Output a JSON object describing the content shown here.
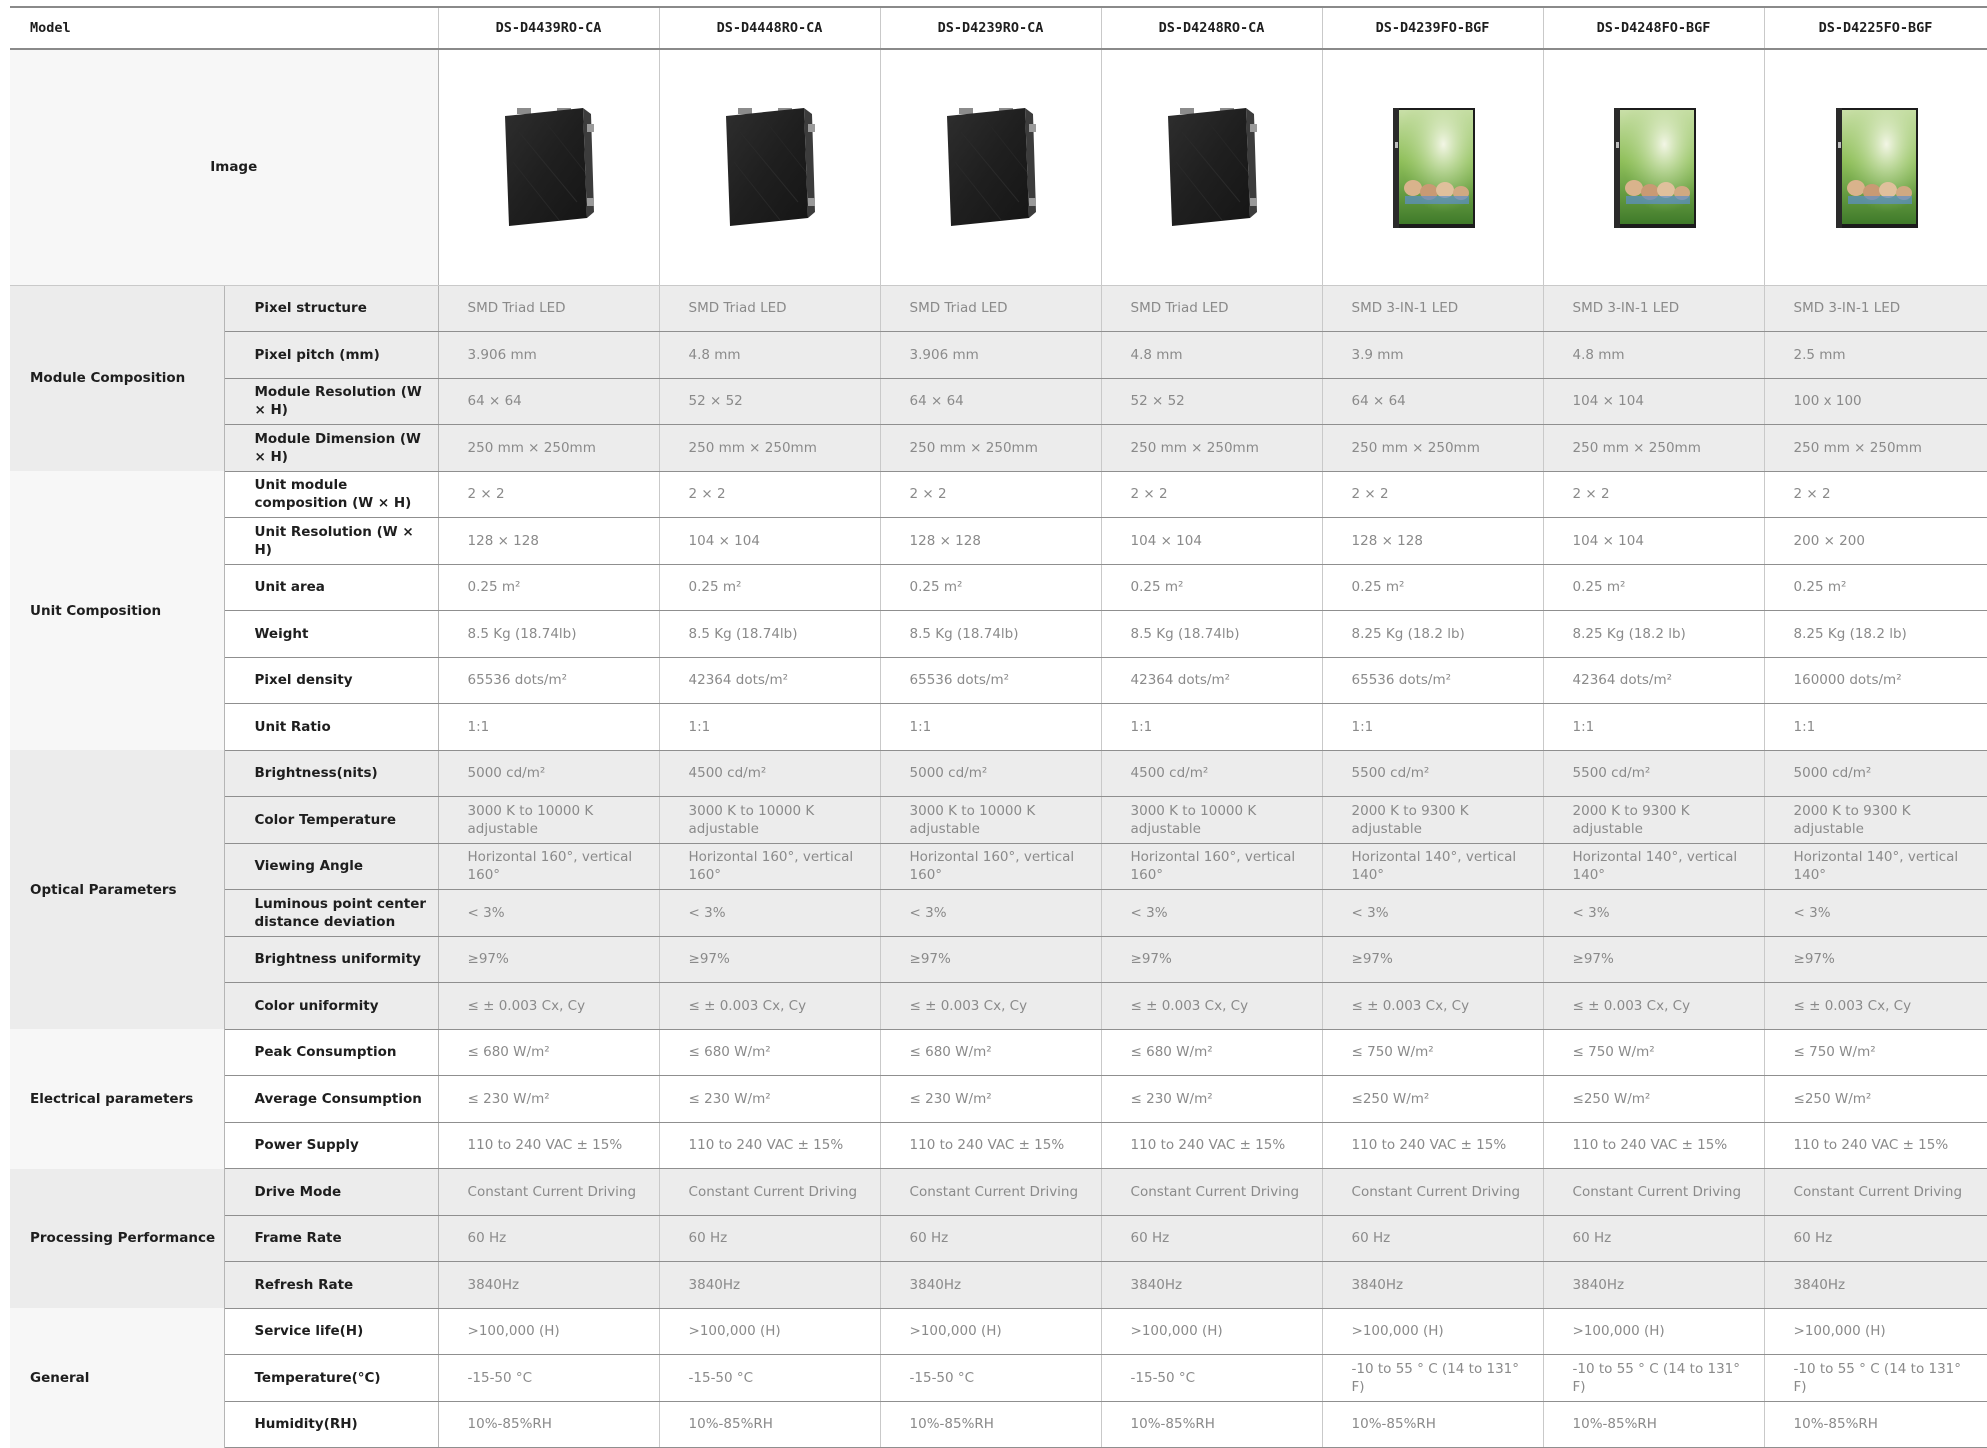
{
  "table": {
    "corner_label": "Model",
    "image_row_label": "Image",
    "models": [
      {
        "name": "DS-D4439RO-CA",
        "image": "dark-panel"
      },
      {
        "name": "DS-D4448RO-CA",
        "image": "dark-panel"
      },
      {
        "name": "DS-D4239RO-CA",
        "image": "dark-panel"
      },
      {
        "name": "DS-D4248RO-CA",
        "image": "dark-panel"
      },
      {
        "name": "DS-D4239FO-BGF",
        "image": "photo-panel"
      },
      {
        "name": "DS-D4248FO-BGF",
        "image": "photo-panel"
      },
      {
        "name": "DS-D4225FO-BGF",
        "image": "photo-panel"
      }
    ],
    "groups": [
      {
        "name": "Module Composition",
        "shaded": true,
        "rows": [
          {
            "param": "Pixel structure",
            "values": [
              "SMD Triad LED",
              "SMD Triad LED",
              "SMD Triad LED",
              "SMD Triad LED",
              "SMD 3-IN-1 LED",
              "SMD 3-IN-1 LED",
              "SMD 3-IN-1 LED"
            ]
          },
          {
            "param": "Pixel pitch (mm)",
            "values": [
              "3.906 mm",
              "4.8 mm",
              "3.906 mm",
              "4.8 mm",
              "3.9 mm",
              "4.8 mm",
              "2.5 mm"
            ]
          },
          {
            "param": "Module Resolution (W × H)",
            "values": [
              "64 × 64",
              "52 × 52",
              "64 × 64",
              "52 × 52",
              "64 × 64",
              "104 × 104",
              "100 x 100"
            ]
          },
          {
            "param": "Module Dimension (W × H)",
            "values": [
              "250 mm × 250mm",
              "250 mm × 250mm",
              "250 mm × 250mm",
              "250 mm × 250mm",
              "250 mm × 250mm",
              "250 mm × 250mm",
              "250 mm × 250mm"
            ]
          }
        ]
      },
      {
        "name": "Unit Composition",
        "shaded": false,
        "rows": [
          {
            "param": "Unit module composition (W × H)",
            "values": [
              "2 × 2",
              "2 × 2",
              "2 × 2",
              "2 × 2",
              "2 × 2",
              "2 × 2",
              "2 × 2"
            ]
          },
          {
            "param": "Unit Resolution (W × H)",
            "values": [
              "128 × 128",
              "104 × 104",
              "128 × 128",
              "104 × 104",
              "128 × 128",
              "104 × 104",
              "200 × 200"
            ]
          },
          {
            "param": "Unit area",
            "values": [
              "0.25 m²",
              "0.25 m²",
              "0.25 m²",
              "0.25 m²",
              "0.25 m²",
              "0.25 m²",
              "0.25 m²"
            ]
          },
          {
            "param": "Weight",
            "values": [
              "8.5 Kg (18.74lb)",
              "8.5 Kg (18.74lb)",
              "8.5 Kg (18.74lb)",
              "8.5 Kg (18.74lb)",
              "8.25 Kg (18.2 lb)",
              "8.25 Kg (18.2 lb)",
              "8.25 Kg (18.2 lb)"
            ]
          },
          {
            "param": "Pixel density",
            "values": [
              "65536 dots/m²",
              "42364 dots/m²",
              "65536 dots/m²",
              "42364 dots/m²",
              "65536 dots/m²",
              "42364 dots/m²",
              "160000 dots/m²"
            ]
          },
          {
            "param": "Unit Ratio",
            "values": [
              "1:1",
              "1:1",
              "1:1",
              "1:1",
              "1:1",
              "1:1",
              "1:1"
            ]
          }
        ]
      },
      {
        "name": "Optical Parameters",
        "shaded": true,
        "rows": [
          {
            "param": "Brightness(nits)",
            "values": [
              "5000 cd/m²",
              "4500 cd/m²",
              "5000 cd/m²",
              "4500 cd/m²",
              "5500 cd/m²",
              "5500 cd/m²",
              "5000 cd/m²"
            ]
          },
          {
            "param": "Color Temperature",
            "values": [
              "3000 K to 10000 K adjustable",
              "3000 K to 10000 K adjustable",
              "3000 K to 10000 K adjustable",
              "3000 K to 10000 K adjustable",
              "2000 K to 9300 K adjustable",
              "2000 K to 9300 K adjustable",
              "2000 K to 9300 K adjustable"
            ]
          },
          {
            "param": "Viewing Angle",
            "values": [
              "Horizontal 160°, vertical 160°",
              "Horizontal 160°, vertical 160°",
              "Horizontal 160°, vertical 160°",
              "Horizontal 160°, vertical 160°",
              "Horizontal 140°, vertical 140°",
              "Horizontal 140°, vertical 140°",
              "Horizontal 140°, vertical 140°"
            ]
          },
          {
            "param": "Luminous point center distance deviation",
            "values": [
              "< 3%",
              "< 3%",
              "< 3%",
              "< 3%",
              "< 3%",
              "< 3%",
              "< 3%"
            ]
          },
          {
            "param": "Brightness uniformity",
            "values": [
              "≥97%",
              "≥97%",
              "≥97%",
              "≥97%",
              "≥97%",
              "≥97%",
              "≥97%"
            ]
          },
          {
            "param": "Color uniformity",
            "values": [
              "≤ ± 0.003 Cx, Cy",
              "≤ ± 0.003 Cx, Cy",
              "≤ ± 0.003 Cx, Cy",
              "≤ ± 0.003 Cx, Cy",
              "≤ ± 0.003 Cx, Cy",
              "≤ ± 0.003 Cx, Cy",
              "≤ ± 0.003 Cx, Cy"
            ]
          }
        ]
      },
      {
        "name": "Electrical parameters",
        "shaded": false,
        "rows": [
          {
            "param": "Peak Consumption",
            "values": [
              "≤ 680 W/m²",
              "≤ 680 W/m²",
              "≤ 680 W/m²",
              "≤ 680 W/m²",
              "≤ 750 W/m²",
              "≤ 750 W/m²",
              "≤ 750 W/m²"
            ]
          },
          {
            "param": "Average Consumption",
            "values": [
              "≤ 230 W/m²",
              "≤ 230 W/m²",
              "≤ 230 W/m²",
              "≤ 230 W/m²",
              "≤250 W/m²",
              "≤250 W/m²",
              "≤250 W/m²"
            ]
          },
          {
            "param": "Power Supply",
            "values": [
              "110 to 240 VAC ± 15%",
              "110 to 240 VAC ± 15%",
              "110 to 240 VAC ± 15%",
              "110 to 240 VAC ± 15%",
              "110 to 240 VAC ± 15%",
              "110 to 240 VAC ± 15%",
              "110 to 240 VAC ± 15%"
            ]
          }
        ]
      },
      {
        "name": "Processing Performance",
        "shaded": true,
        "rows": [
          {
            "param": "Drive Mode",
            "values": [
              "Constant Current Driving",
              "Constant Current Driving",
              "Constant Current Driving",
              "Constant Current Driving",
              "Constant Current Driving",
              "Constant Current Driving",
              "Constant Current Driving"
            ]
          },
          {
            "param": "Frame Rate",
            "values": [
              "60 Hz",
              "60 Hz",
              "60 Hz",
              "60 Hz",
              "60 Hz",
              "60 Hz",
              "60 Hz"
            ]
          },
          {
            "param": "Refresh Rate",
            "values": [
              "3840Hz",
              "3840Hz",
              "3840Hz",
              "3840Hz",
              "3840Hz",
              "3840Hz",
              "3840Hz"
            ]
          }
        ]
      },
      {
        "name": "General",
        "shaded": false,
        "rows": [
          {
            "param": "Service life(H)",
            "values": [
              ">100,000 (H)",
              ">100,000 (H)",
              ">100,000 (H)",
              ">100,000 (H)",
              ">100,000 (H)",
              ">100,000 (H)",
              ">100,000 (H)"
            ]
          },
          {
            "param": "Temperature(°C)",
            "values": [
              "-15-50 °C",
              "-15-50 °C",
              "-15-50 °C",
              "-15-50 °C",
              "-10 to 55 ° C (14 to 131° F)",
              "-10 to 55 ° C (14 to 131° F)",
              "-10 to 55 ° C (14 to 131° F)"
            ]
          },
          {
            "param": "Humidity(RH)",
            "values": [
              "10%-85%RH",
              "10%-85%RH",
              "10%-85%RH",
              "10%-85%RH",
              "10%-85%RH",
              "10%-85%RH",
              "10%-85%RH"
            ]
          }
        ]
      }
    ]
  }
}
